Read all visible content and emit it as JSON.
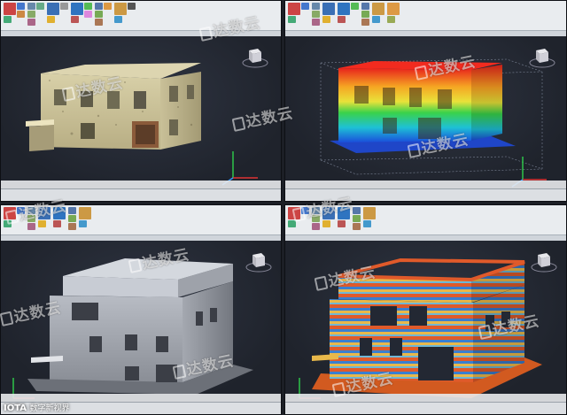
{
  "watermark": "达数云",
  "footer": {
    "logo": "IOTA",
    "caption": "数字新视界"
  },
  "panes": [
    {
      "id": "tl",
      "render_mode": "rgb"
    },
    {
      "id": "tr",
      "render_mode": "elevation"
    },
    {
      "id": "bl",
      "render_mode": "intensity"
    },
    {
      "id": "br",
      "render_mode": "banded"
    }
  ],
  "colors": {
    "ribbon": "#e9ecef",
    "viewport": "#262a33",
    "accent_blue": "#2f74c0",
    "statusbar": "#dcdfe3"
  }
}
